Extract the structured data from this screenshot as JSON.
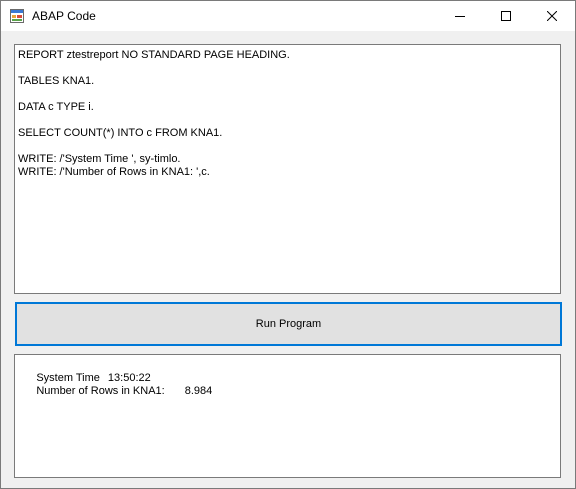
{
  "window": {
    "title": "ABAP Code",
    "icon": "app-form-icon"
  },
  "caption_buttons": {
    "minimize_icon": "minimize-icon",
    "maximize_icon": "maximize-icon",
    "close_icon": "close-icon"
  },
  "code_editor": {
    "lines": [
      "REPORT ztestreport NO STANDARD PAGE HEADING.",
      "TABLES KNA1.",
      "DATA c TYPE i.",
      "SELECT COUNT(*) INTO c FROM KNA1.",
      "WRITE: /'System Time ', sy-timlo.",
      "WRITE: /'Number of Rows in KNA1: ',c."
    ]
  },
  "run_button": {
    "label": "Run Program",
    "focus_color": "#0078d7"
  },
  "output": {
    "line1_label": "System Time",
    "line1_value": "13:50:22",
    "line2_label": "Number of Rows in KNA1:",
    "line2_value": "8.984"
  }
}
